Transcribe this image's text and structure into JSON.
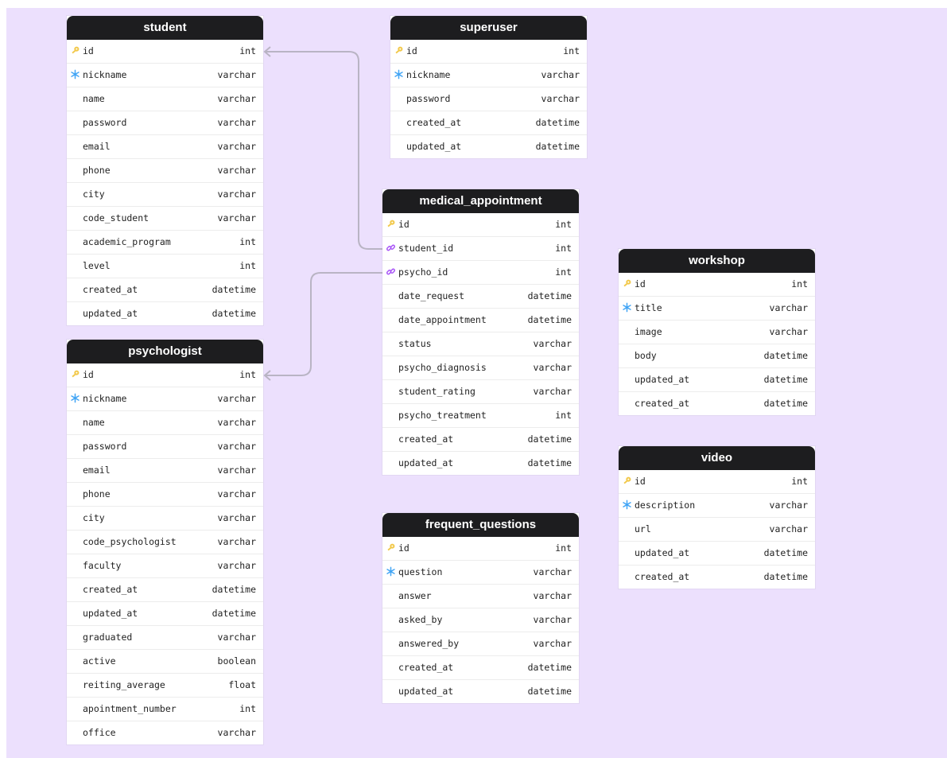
{
  "colors": {
    "canvas": "#ece0fd",
    "header": "#1d1d1f",
    "key": "#f2c94c",
    "unique": "#42a5f5",
    "link": "#a855f7",
    "edge": "#b9b4c4"
  },
  "tables": {
    "student": {
      "title": "student",
      "columns": [
        {
          "name": "id",
          "type": "int",
          "icon": "key-icon"
        },
        {
          "name": "nickname",
          "type": "varchar",
          "icon": "unique-icon"
        },
        {
          "name": "name",
          "type": "varchar",
          "icon": ""
        },
        {
          "name": "password",
          "type": "varchar",
          "icon": ""
        },
        {
          "name": "email",
          "type": "varchar",
          "icon": ""
        },
        {
          "name": "phone",
          "type": "varchar",
          "icon": ""
        },
        {
          "name": "city",
          "type": "varchar",
          "icon": ""
        },
        {
          "name": "code_student",
          "type": "varchar",
          "icon": ""
        },
        {
          "name": "academic_program",
          "type": "int",
          "icon": ""
        },
        {
          "name": "level",
          "type": "int",
          "icon": ""
        },
        {
          "name": "created_at",
          "type": "datetime",
          "icon": ""
        },
        {
          "name": "updated_at",
          "type": "datetime",
          "icon": ""
        }
      ]
    },
    "superuser": {
      "title": "superuser",
      "columns": [
        {
          "name": "id",
          "type": "int",
          "icon": "key-icon"
        },
        {
          "name": "nickname",
          "type": "varchar",
          "icon": "unique-icon"
        },
        {
          "name": "password",
          "type": "varchar",
          "icon": ""
        },
        {
          "name": "created_at",
          "type": "datetime",
          "icon": ""
        },
        {
          "name": "updated_at",
          "type": "datetime",
          "icon": ""
        }
      ]
    },
    "medical_appointment": {
      "title": "medical_appointment",
      "columns": [
        {
          "name": "id",
          "type": "int",
          "icon": "key-icon"
        },
        {
          "name": "student_id",
          "type": "int",
          "icon": "link-icon"
        },
        {
          "name": "psycho_id",
          "type": "int",
          "icon": "link-icon"
        },
        {
          "name": "date_request",
          "type": "datetime",
          "icon": ""
        },
        {
          "name": "date_appointment",
          "type": "datetime",
          "icon": ""
        },
        {
          "name": "status",
          "type": "varchar",
          "icon": ""
        },
        {
          "name": "psycho_diagnosis",
          "type": "varchar",
          "icon": ""
        },
        {
          "name": "student_rating",
          "type": "varchar",
          "icon": ""
        },
        {
          "name": "psycho_treatment",
          "type": "int",
          "icon": ""
        },
        {
          "name": "created_at",
          "type": "datetime",
          "icon": ""
        },
        {
          "name": "updated_at",
          "type": "datetime",
          "icon": ""
        }
      ]
    },
    "workshop": {
      "title": "workshop",
      "columns": [
        {
          "name": "id",
          "type": "int",
          "icon": "key-icon"
        },
        {
          "name": "title",
          "type": "varchar",
          "icon": "unique-icon"
        },
        {
          "name": "image",
          "type": "varchar",
          "icon": ""
        },
        {
          "name": "body",
          "type": "datetime",
          "icon": ""
        },
        {
          "name": "updated_at",
          "type": "datetime",
          "icon": ""
        },
        {
          "name": "created_at",
          "type": "datetime",
          "icon": ""
        }
      ]
    },
    "psychologist": {
      "title": "psychologist",
      "columns": [
        {
          "name": "id",
          "type": "int",
          "icon": "key-icon"
        },
        {
          "name": "nickname",
          "type": "varchar",
          "icon": "unique-icon"
        },
        {
          "name": "name",
          "type": "varchar",
          "icon": ""
        },
        {
          "name": "password",
          "type": "varchar",
          "icon": ""
        },
        {
          "name": "email",
          "type": "varchar",
          "icon": ""
        },
        {
          "name": "phone",
          "type": "varchar",
          "icon": ""
        },
        {
          "name": "city",
          "type": "varchar",
          "icon": ""
        },
        {
          "name": "code_psychologist",
          "type": "varchar",
          "icon": ""
        },
        {
          "name": "faculty",
          "type": "varchar",
          "icon": ""
        },
        {
          "name": "created_at",
          "type": "datetime",
          "icon": ""
        },
        {
          "name": "updated_at",
          "type": "datetime",
          "icon": ""
        },
        {
          "name": "graduated",
          "type": "varchar",
          "icon": ""
        },
        {
          "name": "active",
          "type": "boolean",
          "icon": ""
        },
        {
          "name": "reiting_average",
          "type": "float",
          "icon": ""
        },
        {
          "name": "apointment_number",
          "type": "int",
          "icon": ""
        },
        {
          "name": "office",
          "type": "varchar",
          "icon": ""
        }
      ]
    },
    "video": {
      "title": "video",
      "columns": [
        {
          "name": "id",
          "type": "int",
          "icon": "key-icon"
        },
        {
          "name": "description",
          "type": "varchar",
          "icon": "unique-icon"
        },
        {
          "name": "url",
          "type": "varchar",
          "icon": ""
        },
        {
          "name": "updated_at",
          "type": "datetime",
          "icon": ""
        },
        {
          "name": "created_at",
          "type": "datetime",
          "icon": ""
        }
      ]
    },
    "frequent_questions": {
      "title": "frequent_questions",
      "columns": [
        {
          "name": "id",
          "type": "int",
          "icon": "key-icon"
        },
        {
          "name": "question",
          "type": "varchar",
          "icon": "unique-icon"
        },
        {
          "name": "answer",
          "type": "varchar",
          "icon": ""
        },
        {
          "name": "asked_by",
          "type": "varchar",
          "icon": ""
        },
        {
          "name": "answered_by",
          "type": "varchar",
          "icon": ""
        },
        {
          "name": "created_at",
          "type": "datetime",
          "icon": ""
        },
        {
          "name": "updated_at",
          "type": "datetime",
          "icon": ""
        }
      ]
    }
  },
  "relations": [
    {
      "from_table": "medical_appointment",
      "from_column": "student_id",
      "to_table": "student",
      "to_column": "id"
    },
    {
      "from_table": "medical_appointment",
      "from_column": "psycho_id",
      "to_table": "psychologist",
      "to_column": "id"
    }
  ]
}
